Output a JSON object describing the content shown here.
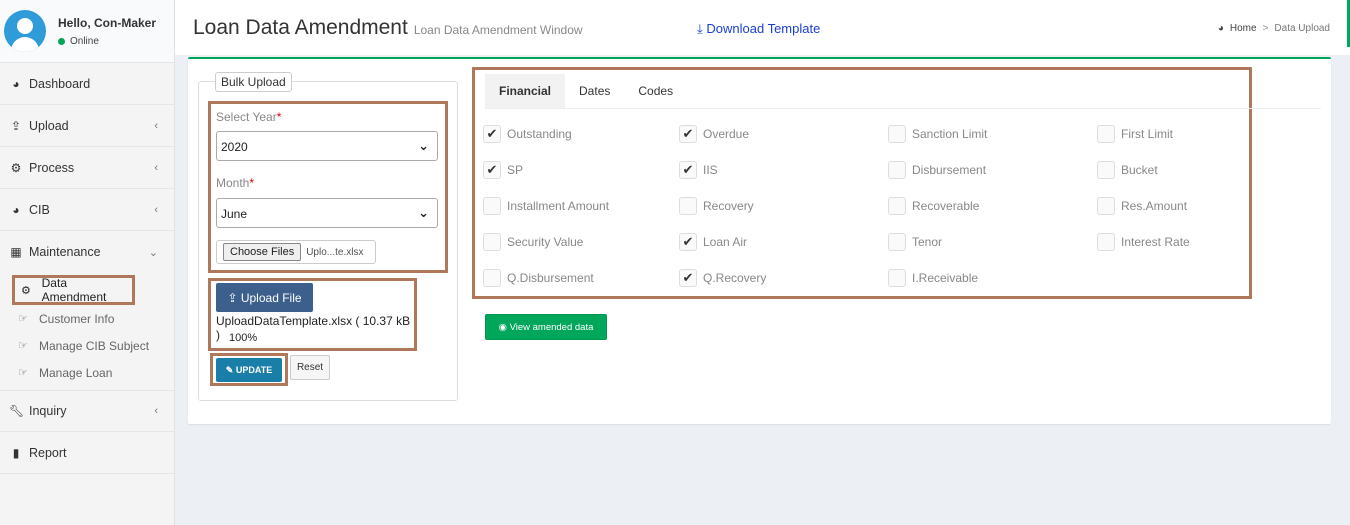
{
  "user": {
    "greeting": "Hello, Con-Maker",
    "status": "Online"
  },
  "sidebar": {
    "items": [
      {
        "label": "Dashboard",
        "icon": "dashboard-icon"
      },
      {
        "label": "Upload",
        "icon": "upload-icon"
      },
      {
        "label": "Process",
        "icon": "gears-icon"
      },
      {
        "label": "CIB",
        "icon": "dashboard-icon"
      },
      {
        "label": "Maintenance",
        "icon": "grid-icon"
      }
    ],
    "submenu": [
      {
        "label": "Data Amendment",
        "icon": "gear-icon"
      },
      {
        "label": "Customer Info",
        "icon": "hand-point-icon"
      },
      {
        "label": "Manage CIB Subject",
        "icon": "hand-point-icon"
      },
      {
        "label": "Manage Loan",
        "icon": "hand-point-icon"
      }
    ],
    "bottom_items": [
      {
        "label": "Inquiry",
        "icon": "wrench-icon"
      },
      {
        "label": "Report",
        "icon": "bar-chart-icon"
      }
    ]
  },
  "header": {
    "title": "Loan Data Amendment",
    "subtitle": "Loan Data Amendment Window",
    "download_label": "Download Template",
    "breadcrumb": {
      "home": "Home",
      "current": "Data Upload"
    }
  },
  "bulk": {
    "legend": "Bulk Upload",
    "year_label": "Select Year",
    "year_value": "2020",
    "month_label": "Month",
    "month_value": "June",
    "required_mark": "*",
    "choose_files_label": "Choose Files",
    "chosen_file": "Uplo...te.xlsx",
    "upload_label": "Upload File",
    "upload_info": "UploadDataTemplate.xlsx ( 10.37 kB )",
    "upload_percent": "100%",
    "update_label": "UPDATE",
    "reset_label": "Reset"
  },
  "tabs": [
    "Financial",
    "Dates",
    "Codes"
  ],
  "fields": [
    {
      "label": "Outstanding",
      "checked": true
    },
    {
      "label": "Overdue",
      "checked": true
    },
    {
      "label": "Sanction Limit",
      "checked": false
    },
    {
      "label": "First Limit",
      "checked": false
    },
    {
      "label": "SP",
      "checked": true
    },
    {
      "label": "IIS",
      "checked": true
    },
    {
      "label": "Disbursement",
      "checked": false
    },
    {
      "label": "Bucket",
      "checked": false
    },
    {
      "label": "Installment Amount",
      "checked": false
    },
    {
      "label": "Recovery",
      "checked": false
    },
    {
      "label": "Recoverable",
      "checked": false
    },
    {
      "label": "Res.Amount",
      "checked": false
    },
    {
      "label": "Security Value",
      "checked": false
    },
    {
      "label": "Loan Air",
      "checked": true
    },
    {
      "label": "Tenor",
      "checked": false
    },
    {
      "label": "Interest Rate",
      "checked": false
    },
    {
      "label": "Q.Disbursement",
      "checked": false
    },
    {
      "label": "Q.Recovery",
      "checked": true
    },
    {
      "label": "I.Receivable",
      "checked": false
    }
  ],
  "view_label": "View amended data",
  "colors": {
    "accent": "#00a65a",
    "highlight": "#b0785a",
    "link": "#1a3fd6"
  }
}
